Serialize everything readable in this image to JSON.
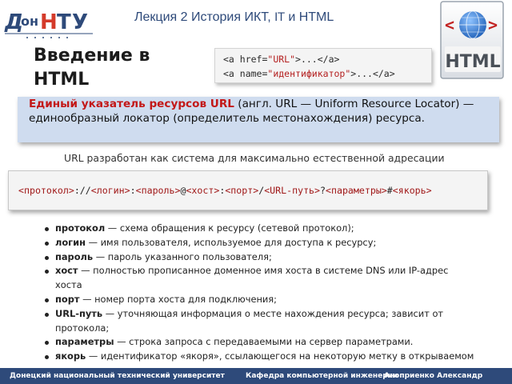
{
  "logo": {
    "alt": "ДонНТУ"
  },
  "header": {
    "lecture_prefix": "Лекция 2 История ИКТ,",
    "lecture_ascii": "IT",
    "lecture_suffix": "и HTML"
  },
  "badge": {
    "text": "HTML",
    "icon": "html-globe-icon"
  },
  "page_title": "Введение в HTML",
  "code_example": {
    "line1_tag_open": "<a ",
    "line1_attr": "href=",
    "line1_value": "\"URL\"",
    "line1_rest": ">...</a>",
    "line2_tag_open": "<a ",
    "line2_attr": "name=",
    "line2_value": "\"идентификатор\"",
    "line2_rest": ">...</a>"
  },
  "definition": {
    "term": "Единый указатель ресурсов URL",
    "text": " (англ. URL — Uniform Resource Locator) — единообразный локатор (определитель местонахождения) ресурса."
  },
  "intro": "URL разработан как система для максимально естественной адресации",
  "syntax": {
    "protocol": "<протокол>",
    "sep1": "://",
    "login": "<логин>",
    "sep2": ":",
    "password": "<пароль>",
    "sep3": "@",
    "host": "<хост>",
    "sep4": ":",
    "port": "<порт>",
    "sep5": "/",
    "path": "<URL‐путь>",
    "sep6": "?",
    "params": "<параметры>",
    "sep7": "#",
    "anchor": "<якорь>"
  },
  "items": [
    {
      "term": "протокол",
      "text": " — схема обращения к ресурсу (сетевой протокол);"
    },
    {
      "term": "логин",
      "text": " — имя пользователя, используемое для доступа к ресурсу;"
    },
    {
      "term": "пароль",
      "text": " — пароль указанного пользователя;"
    },
    {
      "term": "хост",
      "text": " — полностью прописанное доменное имя хоста в системе DNS или IP-адрес хоста"
    },
    {
      "term": "порт",
      "text": " — номер порта хоста для подключения;"
    },
    {
      "term": "URL-путь",
      "text": " — уточняющая информация о месте нахождения ресурса; зависит от протокола;"
    },
    {
      "term": "параметры",
      "text": " — строка запроса с передаваемыми на сервер параметрами."
    },
    {
      "term": "якорь",
      "text": " — идентификатор «якоря», ссылающегося на некоторую метку в открываемом документе."
    }
  ],
  "footer": {
    "university": "Донецкий национальный технический университет",
    "department": "Кафедра компьютерной инженерии",
    "author": "Аноприенко Александр Яковлевич"
  },
  "colors": {
    "accent": "#2e4a7a",
    "definition_bg": "#cfdcef",
    "term_red": "#c31818"
  }
}
